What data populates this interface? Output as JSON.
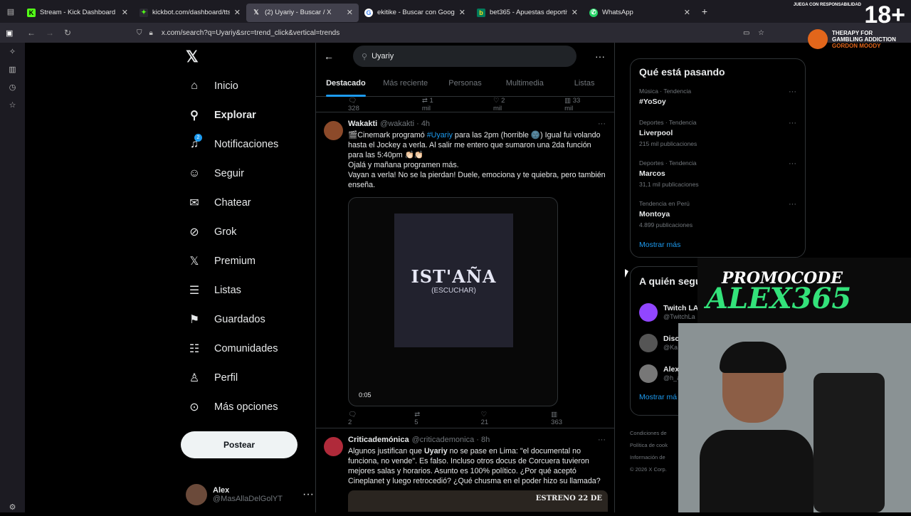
{
  "browser": {
    "tabs": [
      {
        "title": "Stream - Kick Dashboard",
        "icon": "kick-icon",
        "color": "#53fc18"
      },
      {
        "title": "kickbot.com/dashboard/tts/con",
        "icon": "kickbot-icon",
        "color": "#53fc18"
      },
      {
        "title": "(2) Uyariy - Buscar / X",
        "icon": "x-icon",
        "color": "#ffffff"
      },
      {
        "title": "ekitike - Buscar con Google",
        "icon": "google-icon",
        "color": "#4285f4"
      },
      {
        "title": "bet365 - Apuestas deportivas e",
        "icon": "bet365-icon",
        "color": "#027b5b"
      },
      {
        "title": "WhatsApp",
        "icon": "whatsapp-icon",
        "color": "#25d366"
      }
    ],
    "url": "x.com/search?q=Uyariy&src=trend_click&vertical=trends"
  },
  "nav": {
    "items": [
      {
        "label": "Inicio",
        "icon": "home-icon"
      },
      {
        "label": "Explorar",
        "icon": "search-icon"
      },
      {
        "label": "Notificaciones",
        "icon": "bell-icon"
      },
      {
        "label": "Seguir",
        "icon": "follow-icon"
      },
      {
        "label": "Chatear",
        "icon": "mail-icon"
      },
      {
        "label": "Grok",
        "icon": "grok-icon"
      },
      {
        "label": "Premium",
        "icon": "x-premium-icon"
      },
      {
        "label": "Listas",
        "icon": "list-icon"
      },
      {
        "label": "Guardados",
        "icon": "bookmark-icon"
      },
      {
        "label": "Comunidades",
        "icon": "communities-icon"
      },
      {
        "label": "Perfil",
        "icon": "person-icon"
      },
      {
        "label": "Más opciones",
        "icon": "more-icon"
      }
    ],
    "notif_count": "2",
    "post_label": "Postear",
    "profile": {
      "name": "Alex",
      "handle": "@MasAllaDelGolYT"
    }
  },
  "search": {
    "query": "Uyariy"
  },
  "tabs": [
    "Destacado",
    "Más reciente",
    "Personas",
    "Multimedia",
    "Listas"
  ],
  "prev_stats": {
    "replies": "328",
    "reposts": "1 mil",
    "likes": "2 mil",
    "views": "33 mil"
  },
  "tweets": [
    {
      "name": "Wakakti",
      "handle": "@wakakti",
      "time": "4h",
      "text_a": "🎬Cinemark programó ",
      "hashtag": "#Uyariy",
      "text_b": " para las 2pm (horrible 🌚) Igual fui volando hasta el Jockey a verla. Al salir me entero que sumaron una 2da función para las 5:40pm 👏🏻👏🏻",
      "text_c": "Ojalá y mañana programen más.",
      "text_d": "Vayan a verla! No se la pierdan! Duele, emociona y te quiebra, pero también enseña.",
      "video": {
        "title": "IST'AÑA",
        "subtitle": "(ESCUCHAR)",
        "time": "0:05"
      },
      "stats": {
        "replies": "2",
        "reposts": "5",
        "likes": "21",
        "views": "363"
      }
    },
    {
      "name": "Criticademónica",
      "handle": "@criticademonica",
      "time": "8h",
      "text_a": "Algunos justifican que ",
      "bold": "Uyariy",
      "text_b": " no se pase en Lima: \"el documental no funciona, no vende\". Es falso. Incluso otros docus de Corcuera tuvieron mejores salas y horarios. Asunto es 100% político. ¿Por qué aceptó Cineplanet y luego retrocedió? ¿Qué chusma en el poder hizo su llamada?",
      "preview": "ESTRENO 22 DE"
    }
  ],
  "trends": {
    "title": "Qué está pasando",
    "items": [
      {
        "category": "Música · Tendencia",
        "name": "#YoSoy",
        "count": ""
      },
      {
        "category": "Deportes · Tendencia",
        "name": "Liverpool",
        "count": "215 mil publicaciones"
      },
      {
        "category": "Deportes · Tendencia",
        "name": "Marcos",
        "count": "31,1 mil publicaciones"
      },
      {
        "category": "Tendencia en Perú",
        "name": "Montoya",
        "count": "4.899 publicaciones"
      }
    ],
    "show_more": "Mostrar más"
  },
  "who_to_follow": {
    "title": "A quién segu",
    "items": [
      {
        "name": "Twitch LA",
        "handle": "@TwitchLa"
      },
      {
        "name": "Disc",
        "handle": "@Ka"
      },
      {
        "name": "Alex",
        "handle": "@h_a"
      }
    ],
    "show_more": "Mostrar má"
  },
  "footer": [
    "Condiciones de",
    "Política de cook",
    "Información de",
    "© 2026 X Corp."
  ],
  "overlay": {
    "age_text": "JUEGA CON RESPONSABILIDAD",
    "age": "18+",
    "therapy": "THERAPY FOR",
    "therapy2": "GAMBLING ADDICTION",
    "therapy3": "GORDON MOODY",
    "promo1": "PROMOCODE",
    "promo2": "ALEX365"
  }
}
